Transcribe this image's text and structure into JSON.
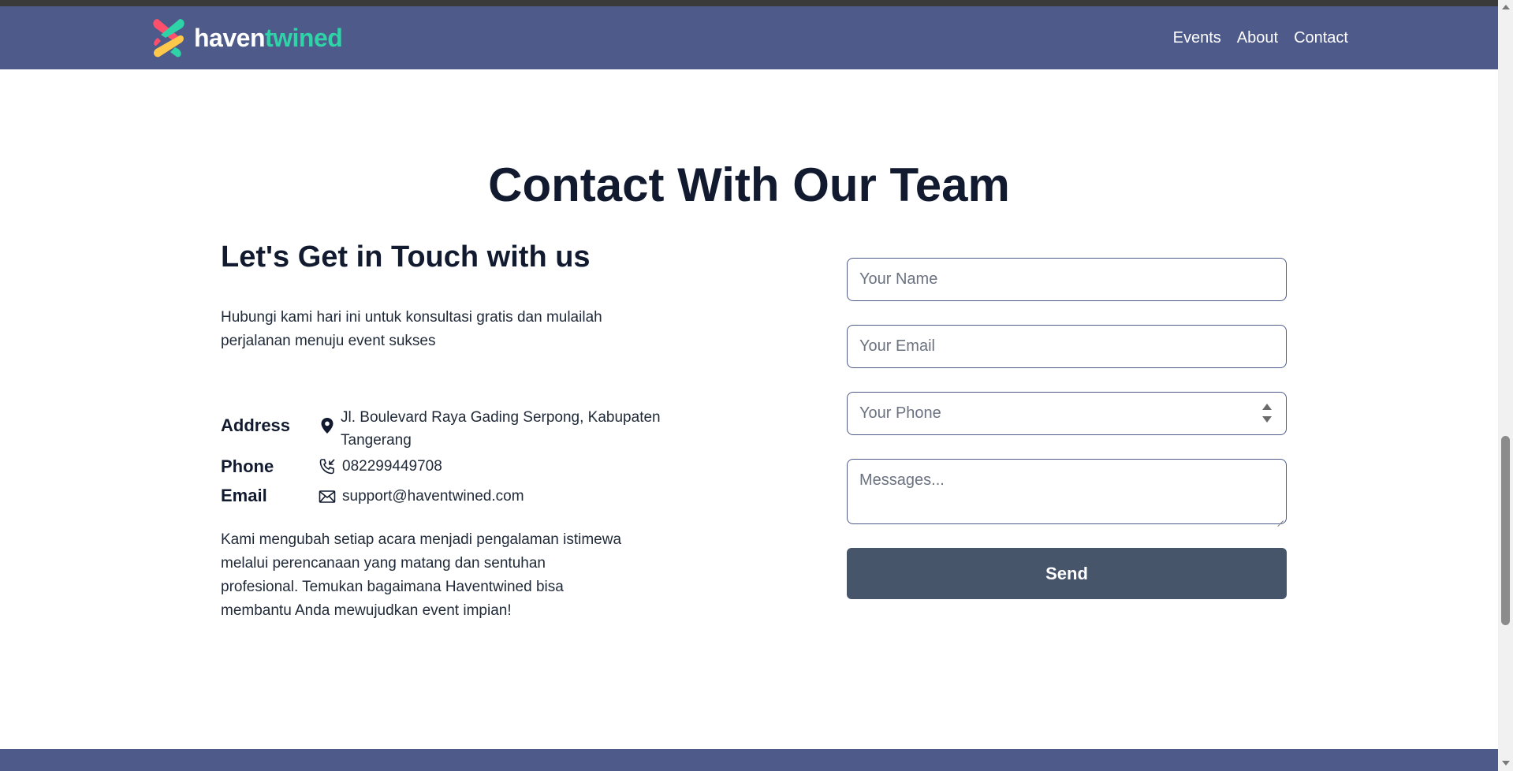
{
  "brand": {
    "part1": "haven",
    "part2": "twined",
    "accent": "#2ed3a7"
  },
  "nav": {
    "items": [
      "Events",
      "About",
      "Contact"
    ]
  },
  "page": {
    "title": "Contact With Our Team"
  },
  "contact": {
    "subtitle": "Let's Get in Touch with us",
    "intro": "Hubungi kami hari ini untuk konsultasi gratis dan mulailah perjalanan menuju event sukses",
    "address": {
      "label": "Address",
      "value": "Jl. Boulevard Raya Gading Serpong, Kabupaten Tangerang",
      "icon": "location-pin-icon"
    },
    "phone": {
      "label": "Phone",
      "value": "082299449708",
      "icon": "phone-icon"
    },
    "email": {
      "label": "Email",
      "value": "support@haventwined.com",
      "icon": "envelope-icon"
    },
    "closing": "Kami mengubah setiap acara menjadi pengalaman istimewa melalui perencanaan yang matang dan sentuhan profesional. Temukan bagaimana Haventwined bisa membantu Anda mewujudkan event impian!"
  },
  "form": {
    "name_placeholder": "Your Name",
    "email_placeholder": "Your Email",
    "phone_placeholder": "Your Phone",
    "message_placeholder": "Messages...",
    "send_label": "Send"
  },
  "colors": {
    "nav_bg": "#4e5a8a",
    "button_bg": "#47556a",
    "title": "#111a2e"
  }
}
